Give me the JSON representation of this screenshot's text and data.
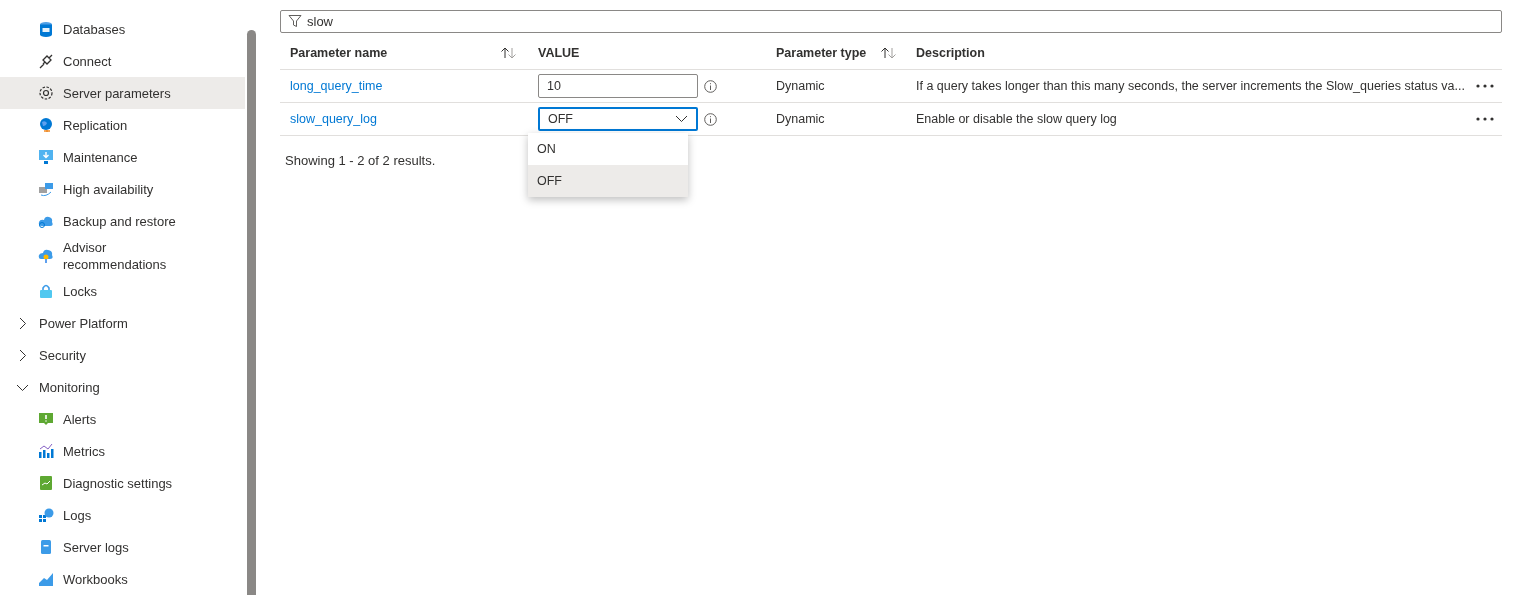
{
  "sidebar": {
    "items": [
      {
        "kind": "item",
        "label": "Databases",
        "selected": false
      },
      {
        "kind": "item",
        "label": "Connect",
        "selected": false
      },
      {
        "kind": "item",
        "label": "Server parameters",
        "selected": true
      },
      {
        "kind": "item",
        "label": "Replication",
        "selected": false
      },
      {
        "kind": "item",
        "label": "Maintenance",
        "selected": false
      },
      {
        "kind": "item",
        "label": "High availability",
        "selected": false
      },
      {
        "kind": "item",
        "label": "Backup and restore",
        "selected": false
      },
      {
        "kind": "item",
        "label": "Advisor recommendations",
        "selected": false
      },
      {
        "kind": "item",
        "label": "Locks",
        "selected": false
      },
      {
        "kind": "group",
        "label": "Power Platform",
        "expanded": false
      },
      {
        "kind": "group",
        "label": "Security",
        "expanded": false
      },
      {
        "kind": "group",
        "label": "Monitoring",
        "expanded": true,
        "children": [
          {
            "kind": "item",
            "label": "Alerts",
            "selected": false
          },
          {
            "kind": "item",
            "label": "Metrics",
            "selected": false
          },
          {
            "kind": "item",
            "label": "Diagnostic settings",
            "selected": false
          },
          {
            "kind": "item",
            "label": "Logs",
            "selected": false
          },
          {
            "kind": "item",
            "label": "Server logs",
            "selected": false
          },
          {
            "kind": "item",
            "label": "Workbooks",
            "selected": false
          }
        ]
      }
    ]
  },
  "filter": {
    "value": "slow"
  },
  "table": {
    "columns": [
      {
        "label": "Parameter name",
        "sortable": true
      },
      {
        "label": "VALUE",
        "sortable": false
      },
      {
        "label": "Parameter type",
        "sortable": true
      },
      {
        "label": "Description",
        "sortable": false
      }
    ],
    "rows": [
      {
        "name": "long_query_time",
        "kind": "text",
        "value": "10",
        "type": "Dynamic",
        "description": "If a query takes longer than this many seconds, the server increments the Slow_queries status va..."
      },
      {
        "name": "slow_query_log",
        "kind": "dropdown",
        "value": "OFF",
        "expanded": true,
        "options": [
          {
            "label": "ON",
            "selected": false
          },
          {
            "label": "OFF",
            "selected": true
          }
        ],
        "type": "Dynamic",
        "description": "Enable or disable the slow query log"
      }
    ]
  },
  "results": "Showing 1 - 2 of 2 results."
}
